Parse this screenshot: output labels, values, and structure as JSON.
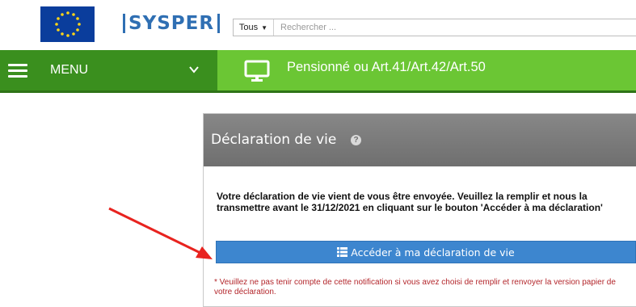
{
  "header": {
    "brand": "SYSPER",
    "search": {
      "scope": "Tous",
      "placeholder": "Rechercher ..."
    }
  },
  "nav": {
    "menu_label": "MENU",
    "page_title": "Pensionné ou Art.41/Art.42/Art.50",
    "colors": {
      "menu_bg": "#3a8f1e",
      "page_bg": "#6bc634"
    }
  },
  "panel": {
    "title": "Déclaration de vie",
    "notice_part1": "Votre déclaration de vie vient de vous être envoyée. Veuillez la remplir et nous la transmettre avant le ",
    "notice_date": "31/12/2021",
    "notice_part2": " en cliquant sur le bouton 'Accéder à ma déclaration'",
    "button_label": "Accéder à ma déclaration de vie",
    "warning": "* Veuillez ne pas tenir compte de cette notification si vous avez choisi de remplir et renvoyer la version papier de votre déclaration.",
    "colors": {
      "button": "#3d86cf",
      "warning": "#b3262b",
      "annotation_arrow": "#e8231f"
    }
  },
  "icons": {
    "flag": "eu-flag-icon",
    "menu": "hamburger-icon",
    "chevron": "chevron-down-icon",
    "monitor": "monitor-icon",
    "help": "help-icon",
    "list": "list-icon"
  }
}
